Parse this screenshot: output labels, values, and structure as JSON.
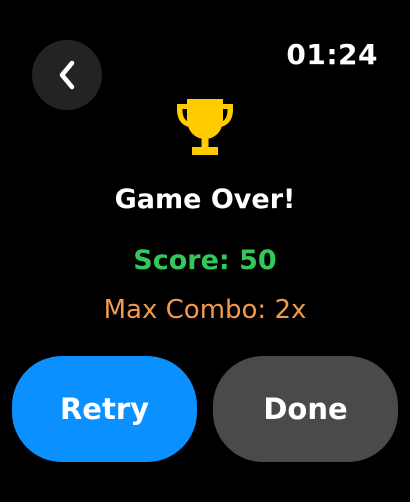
{
  "status_bar": {
    "time": "01:24"
  },
  "header": {
    "back_icon": "chevron-left-icon"
  },
  "result": {
    "icon": "trophy-icon",
    "title": "Game Over!",
    "score_text": "Score: 50",
    "max_combo_text": "Max Combo: 2x"
  },
  "actions": {
    "retry_label": "Retry",
    "done_label": "Done"
  },
  "colors": {
    "background": "#000000",
    "back_button_bg": "#232325",
    "trophy": "#FFCC00",
    "score": "#34C759",
    "combo": "#F2994A",
    "retry_bg": "#0A91FF",
    "done_bg": "#4A4A4C"
  }
}
